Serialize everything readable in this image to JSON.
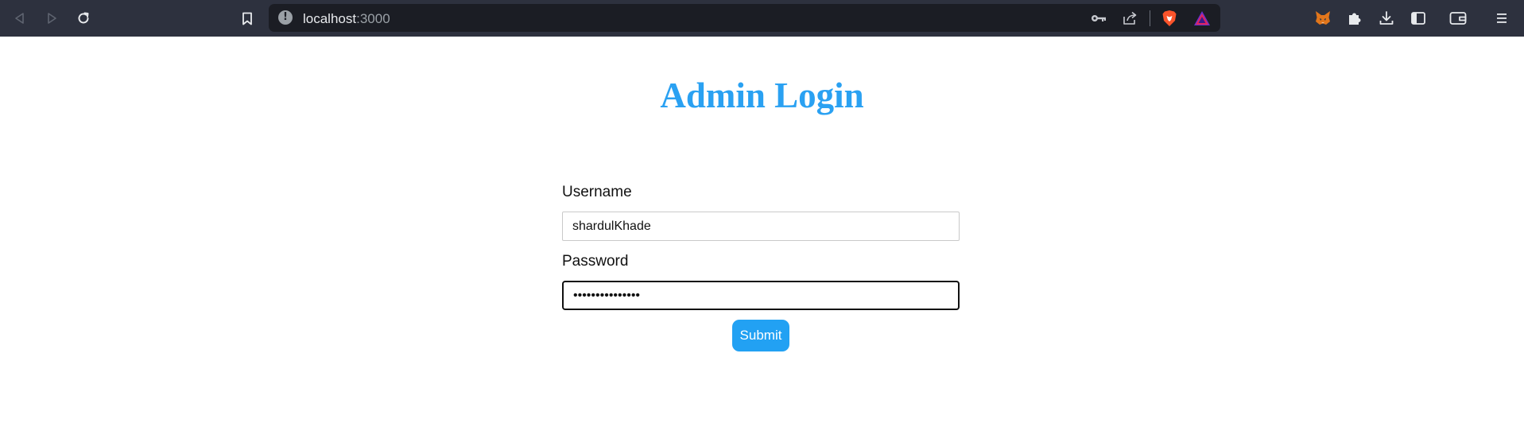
{
  "browser": {
    "url_host": "localhost",
    "url_port": ":3000",
    "site_info_glyph": "!",
    "icons": {
      "back": "back-arrow-icon",
      "forward": "forward-arrow-icon",
      "reload": "reload-icon",
      "bookmark": "bookmark-icon",
      "key": "key-icon",
      "share": "share-icon",
      "brave_shields": "brave-shield-icon",
      "brave_rewards": "brave-rewards-icon",
      "metamask": "metamask-fox-icon",
      "extensions": "puzzle-icon",
      "downloads": "download-icon",
      "sidebar": "sidebar-icon",
      "wallet": "wallet-icon",
      "menu": "hamburger-menu-icon"
    }
  },
  "page": {
    "title": "Admin Login"
  },
  "form": {
    "username_label": "Username",
    "username_value": "shardulKhade",
    "password_label": "Password",
    "password_value": "•••••••••••••••",
    "submit_label": "Submit"
  },
  "colors": {
    "accent": "#22a1f3",
    "title": "#2aa1f2",
    "chrome_bg": "#2d313e",
    "address_bg": "#1b1d24"
  }
}
